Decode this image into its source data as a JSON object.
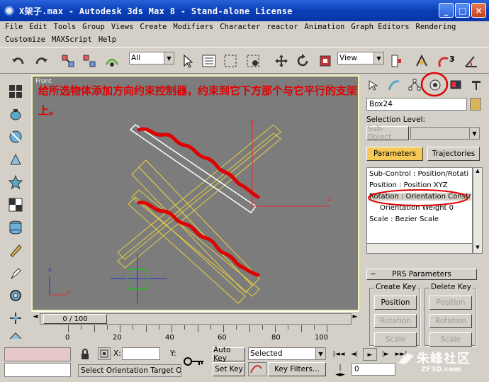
{
  "window": {
    "title": "X架子.max - Autodesk 3ds Max 8 - Stand-alone License",
    "minimize": "_",
    "maximize": "□",
    "close": "×"
  },
  "menu": {
    "row1": [
      "File",
      "Edit",
      "Tools",
      "Group",
      "Views",
      "Create",
      "Modifiers",
      "Character",
      "reactor",
      "Animation",
      "Graph Editors",
      "Rendering"
    ],
    "row2": [
      "Customize",
      "MAXScript",
      "Help"
    ]
  },
  "toolbar": {
    "selection_filter": "All",
    "ref_coord": "View"
  },
  "viewport": {
    "label": "Front",
    "annotation": "给所选物体添加方向约束控制器，约束到它下方那个与它平行的支架上。",
    "axis_x": "x",
    "axis_y": "y",
    "axis_z": "z"
  },
  "timeline": {
    "slider_label": "0 / 100",
    "ticks": [
      "0",
      "20",
      "40",
      "60",
      "80",
      "100"
    ]
  },
  "command_panel": {
    "object_name": "Box24",
    "selection_level_label": "Selection Level:",
    "subobject_button": "Sub-Object",
    "parameters_button": "Parameters",
    "trajectories_button": "Trajectories",
    "controller_list": [
      "Sub-Control : Position/Rotati",
      "Position : Position XYZ",
      "Rotation : Orientation Constr",
      "Orientation Weight 0",
      "Scale : Bezier Scale"
    ],
    "rollout_sign": "−",
    "rollout_title": "PRS Parameters",
    "create_key_label": "Create Key",
    "delete_key_label": "Delete Key",
    "create_buttons": [
      "Position",
      "Rotation",
      "Scale"
    ],
    "delete_buttons": [
      "Position",
      "Rotation",
      "Scale"
    ]
  },
  "status": {
    "x_label": "X:",
    "y_label": "Y:",
    "prompt": "Select Orientation Target Obje",
    "auto_key": "Auto Key",
    "set_key": "Set Key",
    "key_mode": "Selected",
    "key_filters": "Key Filters...",
    "frame": "0"
  },
  "watermark": {
    "text": "朱峰社区",
    "url": "ZF3D.com"
  },
  "colors": {
    "title_bar": "#0a3fb8",
    "viewport_bg": "#7c7c7c",
    "viewport_border": "#f1f1b4",
    "highlight": "#f6c855",
    "annotation": "#e00000"
  }
}
